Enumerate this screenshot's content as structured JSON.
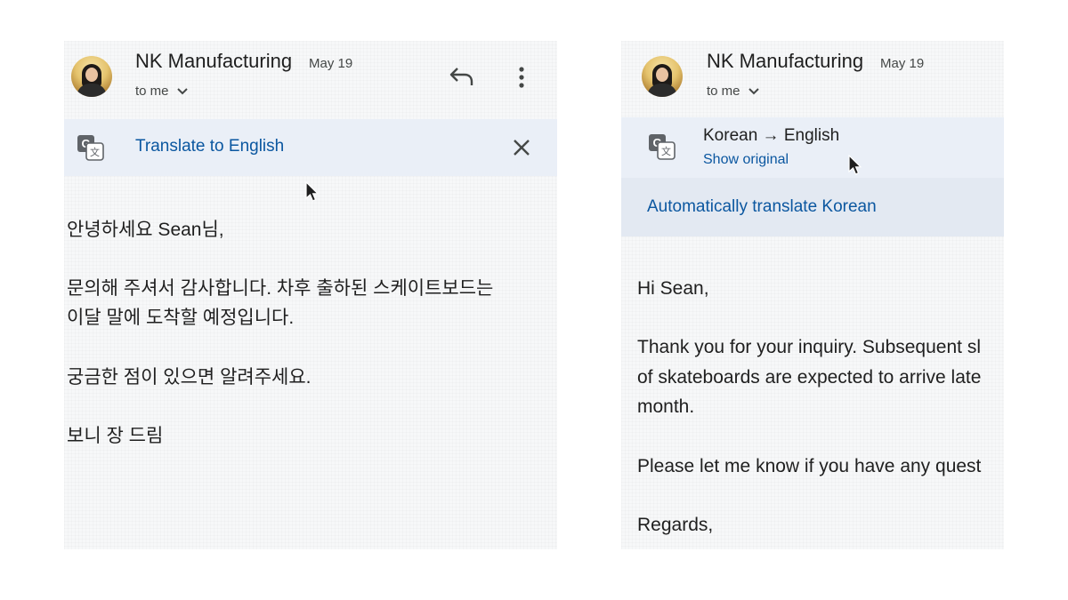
{
  "left_view": {
    "sender": "NK Manufacturing",
    "date": "May 19",
    "recipient": "to me",
    "translate_bar": {
      "link": "Translate to English"
    },
    "body": [
      "안녕하세요 Sean님,",
      "문의해 주셔서 감사합니다. 차후 출하된 스케이트보드는",
      "이달 말에 도착할 예정입니다.",
      "궁금한 점이 있으면 알려주세요.",
      "보니 장 드림"
    ],
    "icons": [
      "avatar",
      "chevron-down-icon",
      "reply-icon",
      "more-vert-icon",
      "google-translate-icon",
      "close-icon",
      "mouse-pointer-icon"
    ]
  },
  "right_view": {
    "sender": "NK Manufacturing",
    "date": "May 19",
    "recipient": "to me",
    "translate_bar": {
      "language_pair": "Korean → English",
      "show_original": "Show original"
    },
    "auto_translate": "Automatically translate Korean",
    "body": [
      "Hi Sean,",
      "Thank you for your inquiry. Subsequent sl",
      "of skateboards are expected to arrive late",
      "month.",
      "Please let me know if you have any quest",
      "Regards,"
    ],
    "icons": [
      "avatar",
      "chevron-down-icon",
      "google-translate-icon",
      "mouse-pointer-icon"
    ]
  },
  "colors": {
    "link_blue": "#0b57a0",
    "translate_bar_bg": "#eaeff7",
    "auto_bar_bg": "#e3e9f2",
    "text": "#1f1f1f",
    "secondary_text": "#444746"
  }
}
